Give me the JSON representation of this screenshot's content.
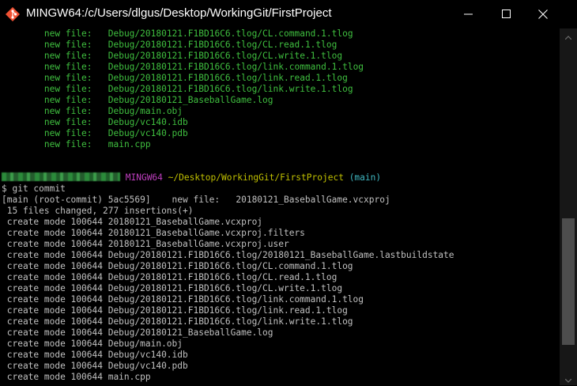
{
  "window": {
    "title": "MINGW64:/c/Users/dlgus/Desktop/WorkingGit/FirstProject",
    "icon": "git-bash-icon",
    "controls": [
      "minimize-icon",
      "maximize-icon",
      "close-icon"
    ]
  },
  "colors": {
    "background": "#000000",
    "text": "#c0c0c0",
    "staged": "#3fbf3f",
    "prompt_host": "#bf3fbf",
    "prompt_path": "#c0c000",
    "prompt_branch": "#3fb6c0"
  },
  "status_lines": [
    {
      "label": "new file:",
      "path": "Debug/20180121.F1BD16C6.tlog/CL.command.1.tlog"
    },
    {
      "label": "new file:",
      "path": "Debug/20180121.F1BD16C6.tlog/CL.read.1.tlog"
    },
    {
      "label": "new file:",
      "path": "Debug/20180121.F1BD16C6.tlog/CL.write.1.tlog"
    },
    {
      "label": "new file:",
      "path": "Debug/20180121.F1BD16C6.tlog/link.command.1.tlog"
    },
    {
      "label": "new file:",
      "path": "Debug/20180121.F1BD16C6.tlog/link.read.1.tlog"
    },
    {
      "label": "new file:",
      "path": "Debug/20180121.F1BD16C6.tlog/link.write.1.tlog"
    },
    {
      "label": "new file:",
      "path": "Debug/20180121_BaseballGame.log"
    },
    {
      "label": "new file:",
      "path": "Debug/main.obj"
    },
    {
      "label": "new file:",
      "path": "Debug/vc140.idb"
    },
    {
      "label": "new file:",
      "path": "Debug/vc140.pdb"
    },
    {
      "label": "new file:",
      "path": "main.cpp"
    }
  ],
  "prompt": {
    "host": "MINGW64",
    "path": "~/Desktop/WorkingGit/FirstProject",
    "branch": "(main)",
    "command": "$ git commit"
  },
  "commit_output": [
    "[main (root-commit) 5ac5569]    new file:   20180121_BaseballGame.vcxproj",
    " 15 files changed, 277 insertions(+)",
    " create mode 100644 20180121_BaseballGame.vcxproj",
    " create mode 100644 20180121_BaseballGame.vcxproj.filters",
    " create mode 100644 20180121_BaseballGame.vcxproj.user",
    " create mode 100644 Debug/20180121.F1BD16C6.tlog/20180121_BaseballGame.lastbuildstate",
    " create mode 100644 Debug/20180121.F1BD16C6.tlog/CL.command.1.tlog",
    " create mode 100644 Debug/20180121.F1BD16C6.tlog/CL.read.1.tlog",
    " create mode 100644 Debug/20180121.F1BD16C6.tlog/CL.write.1.tlog",
    " create mode 100644 Debug/20180121.F1BD16C6.tlog/link.command.1.tlog",
    " create mode 100644 Debug/20180121.F1BD16C6.tlog/link.read.1.tlog",
    " create mode 100644 Debug/20180121.F1BD16C6.tlog/link.write.1.tlog",
    " create mode 100644 Debug/20180121_BaseballGame.log",
    " create mode 100644 Debug/main.obj",
    " create mode 100644 Debug/vc140.idb",
    " create mode 100644 Debug/vc140.pdb",
    " create mode 100644 main.cpp"
  ]
}
